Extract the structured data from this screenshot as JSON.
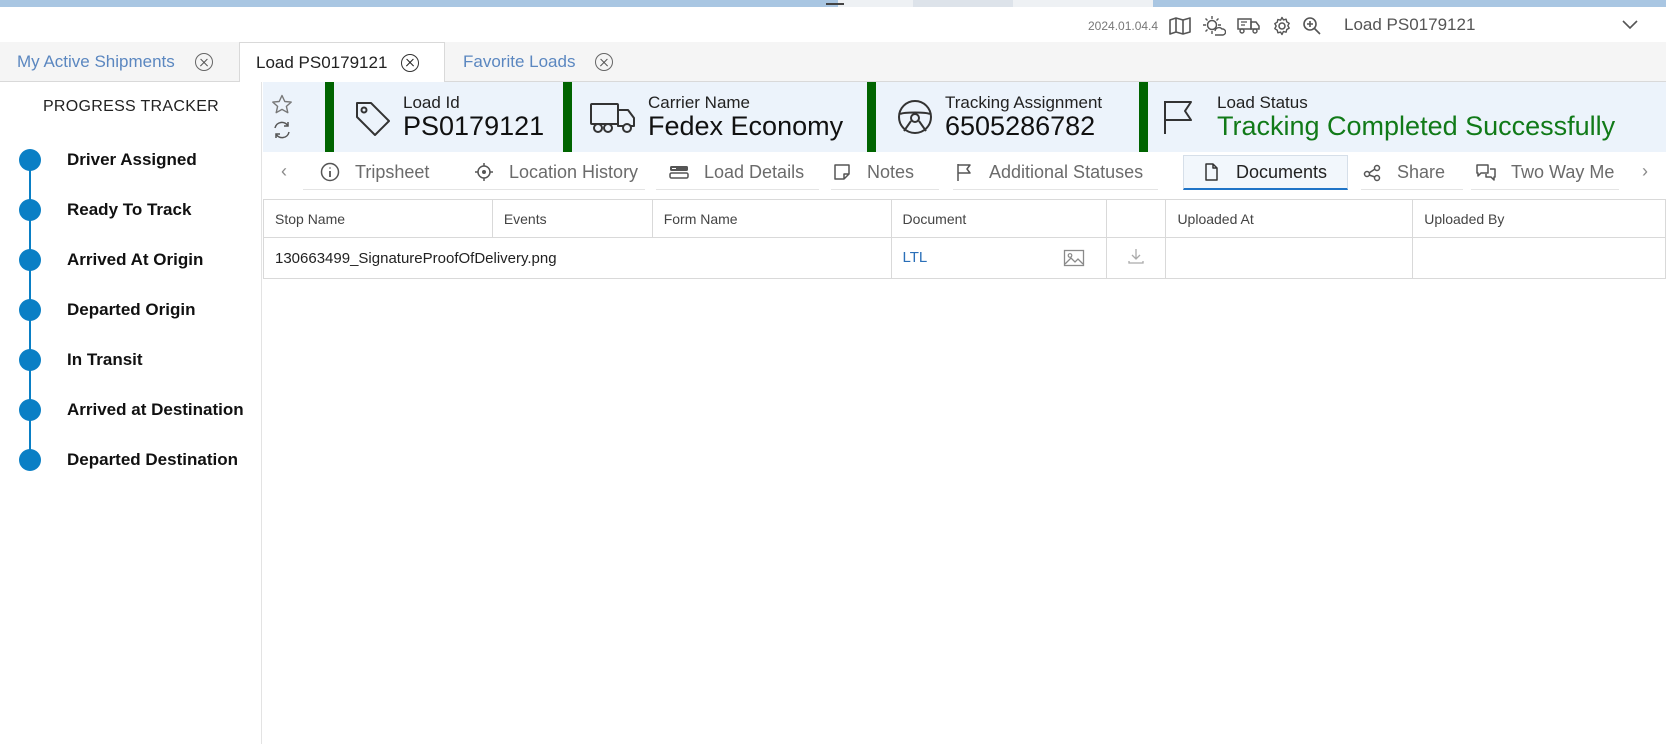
{
  "header": {
    "version": "2024.01.04.4",
    "title": "Load PS0179121",
    "icons": [
      "map-icon",
      "weather-icon",
      "truck-alert-icon",
      "settings-icon",
      "zoom-icon"
    ]
  },
  "tabs": [
    {
      "label": "My Active Shipments",
      "active": false
    },
    {
      "label": "Load PS0179121",
      "active": true
    },
    {
      "label": "Favorite Loads",
      "active": false
    }
  ],
  "progress": {
    "title": "PROGRESS TRACKER",
    "steps": [
      "Driver Assigned",
      "Ready To Track",
      "Arrived At Origin",
      "Departed Origin",
      "In Transit",
      "Arrived at Destination",
      "Departed Destination"
    ]
  },
  "info": {
    "load_id": {
      "label": "Load Id",
      "value": "PS0179121"
    },
    "carrier": {
      "label": "Carrier Name",
      "value": "Fedex Economy"
    },
    "tracking": {
      "label": "Tracking Assignment",
      "value": "6505286782"
    },
    "status": {
      "label": "Load Status",
      "value": "Tracking Completed Successfully"
    },
    "status_color": "#117a18",
    "accent_bar_color": "#006400"
  },
  "subtabs": [
    {
      "label": "Tripsheet",
      "icon": "info-icon"
    },
    {
      "label": "Location History",
      "icon": "location-target-icon"
    },
    {
      "label": "Load Details",
      "icon": "details-icon"
    },
    {
      "label": "Notes",
      "icon": "note-icon"
    },
    {
      "label": "Additional Statuses",
      "icon": "flag-icon"
    },
    {
      "label": "Documents",
      "icon": "document-icon",
      "active": true
    },
    {
      "label": "Share",
      "icon": "share-icon"
    },
    {
      "label": "Two Way Me",
      "icon": "chat-icon"
    }
  ],
  "documents": {
    "columns": [
      "Stop Name",
      "Events",
      "Form Name",
      "Document",
      "",
      "Uploaded At",
      "Uploaded By"
    ],
    "rows": [
      {
        "stop_name": "130663499_SignatureProofOfDelivery.png",
        "events": "",
        "form_name": "",
        "document": "LTL",
        "uploaded_at": "",
        "uploaded_by": ""
      }
    ]
  }
}
